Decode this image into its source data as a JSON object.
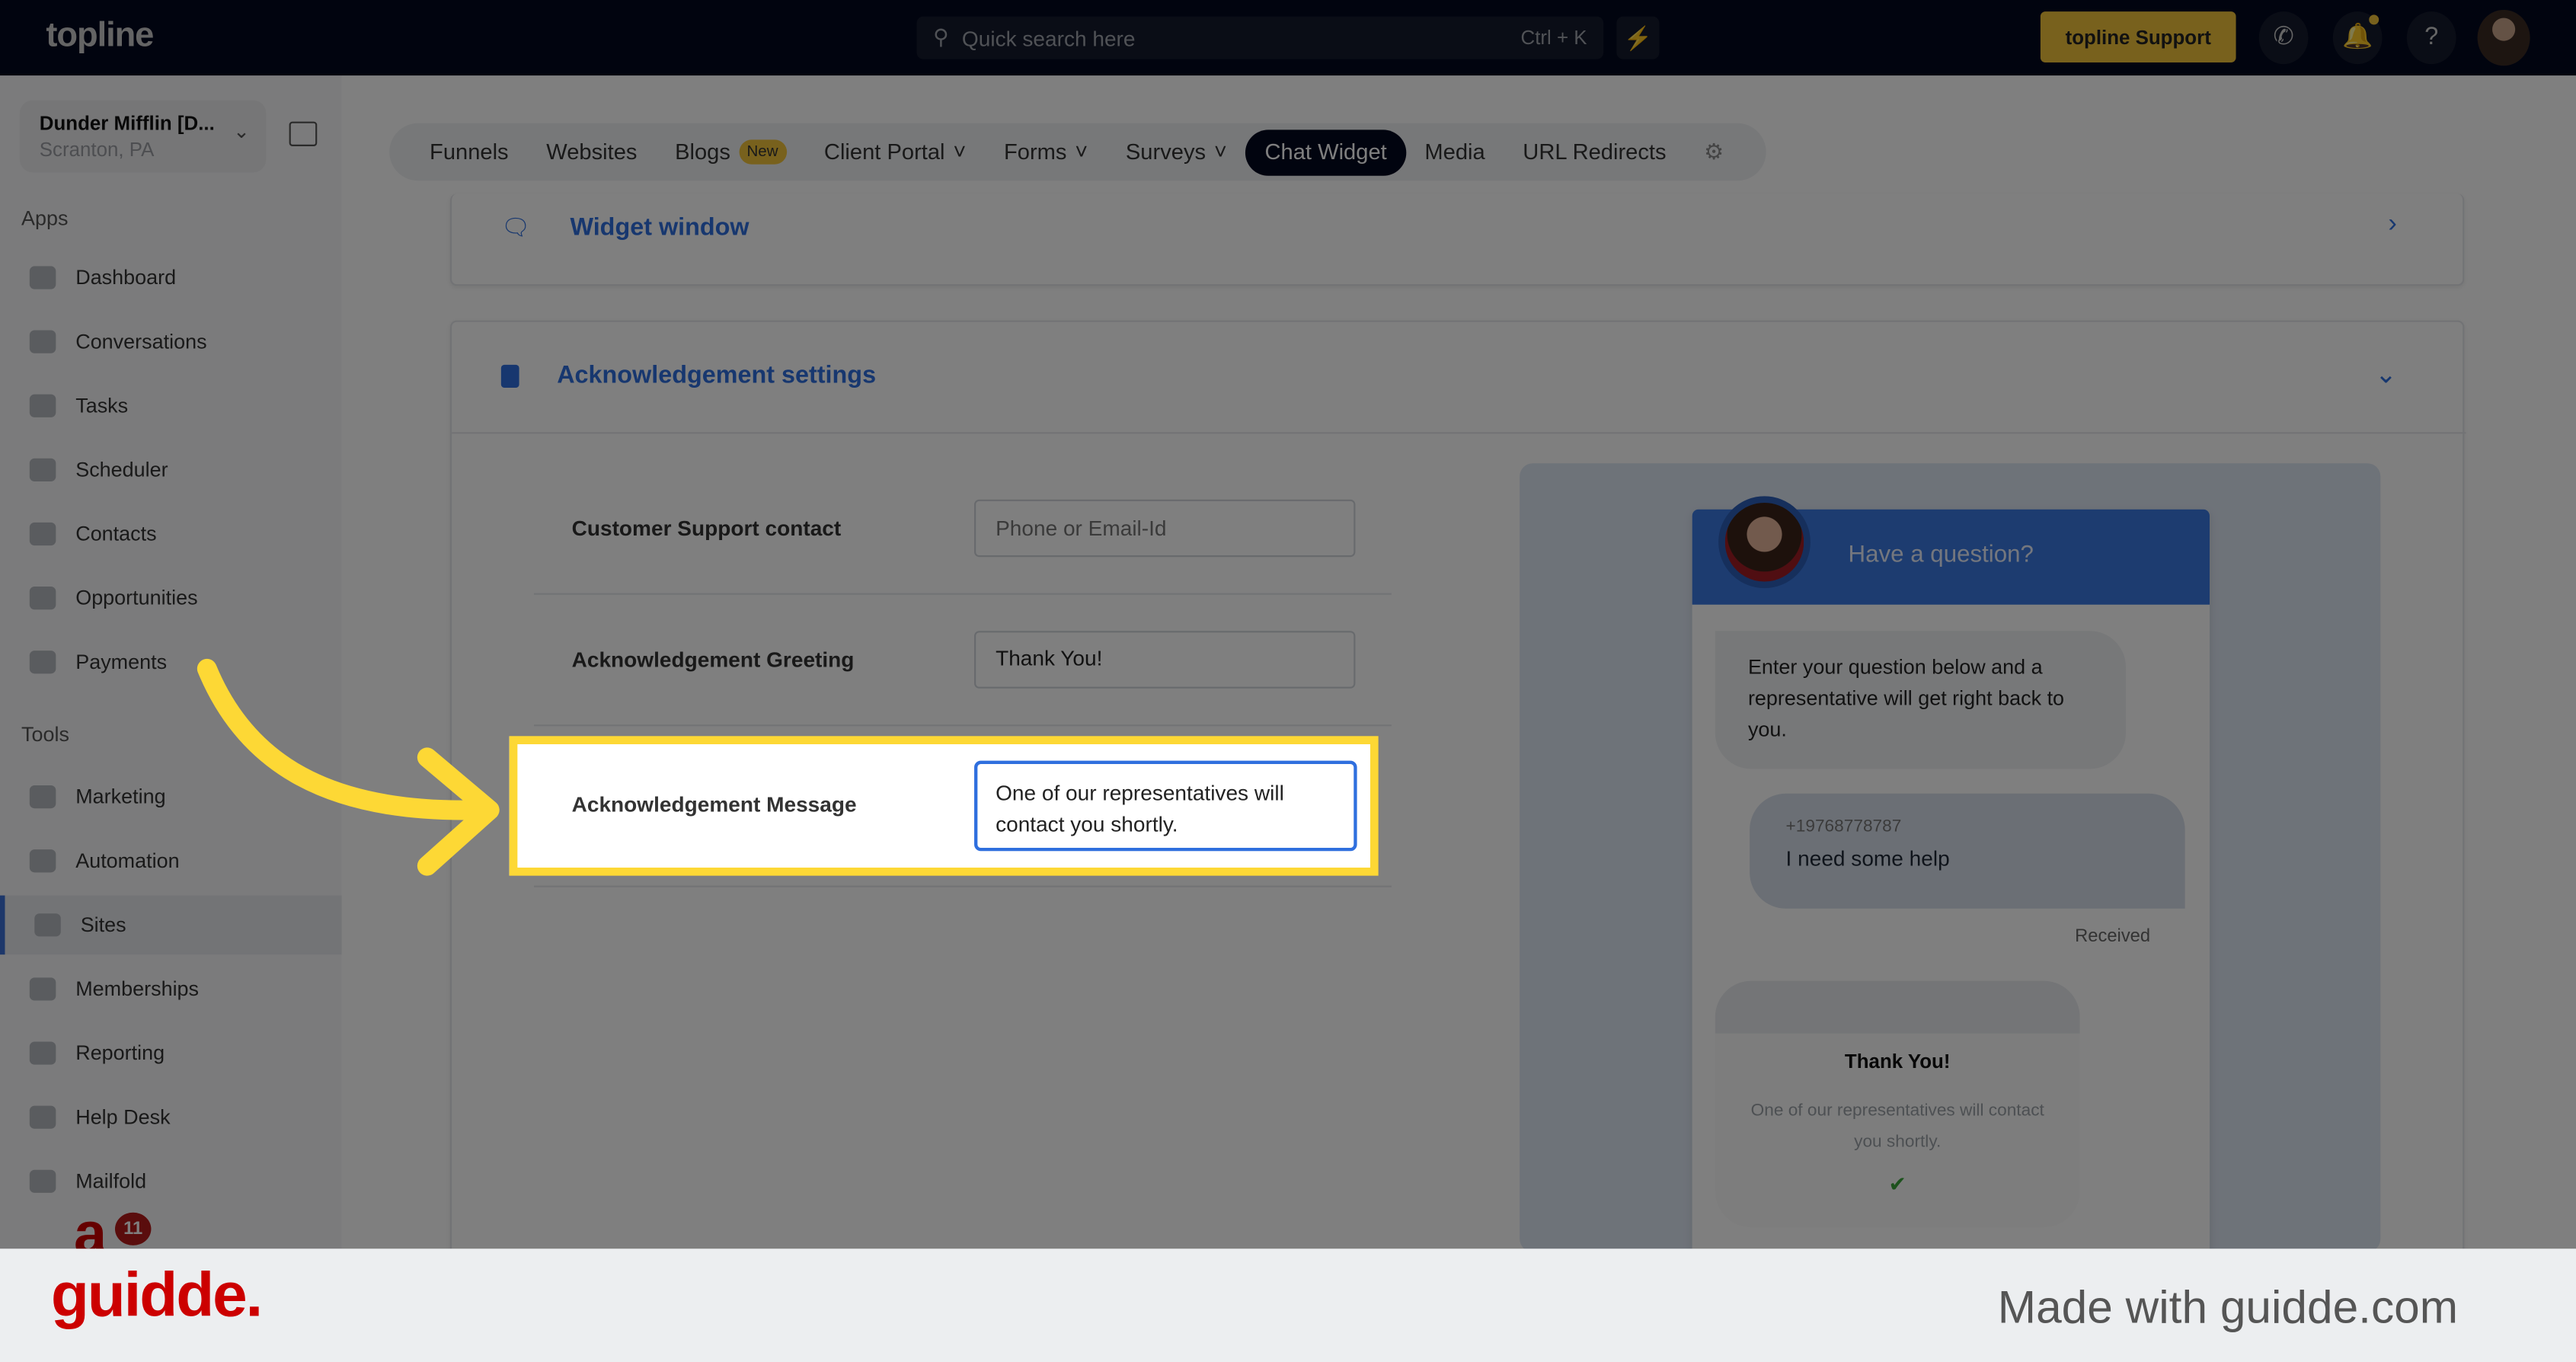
{
  "topbar": {
    "logo": "topline",
    "search_placeholder": "Quick search here",
    "search_shortcut": "Ctrl + K",
    "support_label": "topline Support"
  },
  "account": {
    "name": "Dunder Mifflin [D...",
    "location": "Scranton, PA"
  },
  "sidebar": {
    "apps_label": "Apps",
    "tools_label": "Tools",
    "apps": [
      "Dashboard",
      "Conversations",
      "Tasks",
      "Scheduler",
      "Contacts",
      "Opportunities",
      "Payments"
    ],
    "tools": [
      "Marketing",
      "Automation",
      "Sites",
      "Memberships",
      "Reporting",
      "Help Desk",
      "Mailfold"
    ],
    "active": "Sites",
    "notification_count": "11"
  },
  "tabs": {
    "items": [
      "Funnels",
      "Websites",
      "Blogs",
      "Client Portal",
      "Forms",
      "Surveys",
      "Chat Widget",
      "Media",
      "URL Redirects"
    ],
    "new_badge": "New",
    "active": "Chat Widget"
  },
  "sections": {
    "widget_window": "Widget window",
    "ack_settings": "Acknowledgement settings"
  },
  "form": {
    "support_label": "Customer Support contact",
    "support_placeholder": "Phone or Email-Id",
    "support_value": "",
    "greeting_label": "Acknowledgement Greeting",
    "greeting_value": "Thank You!",
    "message_label": "Acknowledgement Message",
    "message_value": "One of our representatives will contact you shortly."
  },
  "preview": {
    "header": "Have a question?",
    "intro": "Enter your question below and a representative will get right back to you.",
    "phone": "+19768778787",
    "user_msg": "I need some help",
    "status": "Received",
    "ack_title": "Thank You!",
    "ack_message": "One of our representatives will contact you shortly."
  },
  "footer": {
    "logo": "guidde.",
    "tagline": "Made with guidde.com"
  },
  "colors": {
    "accent": "#2f6fde",
    "highlight": "#fdd835",
    "topbar": "#03081f",
    "support": "#f0c33a",
    "guidde": "#cc0000"
  }
}
